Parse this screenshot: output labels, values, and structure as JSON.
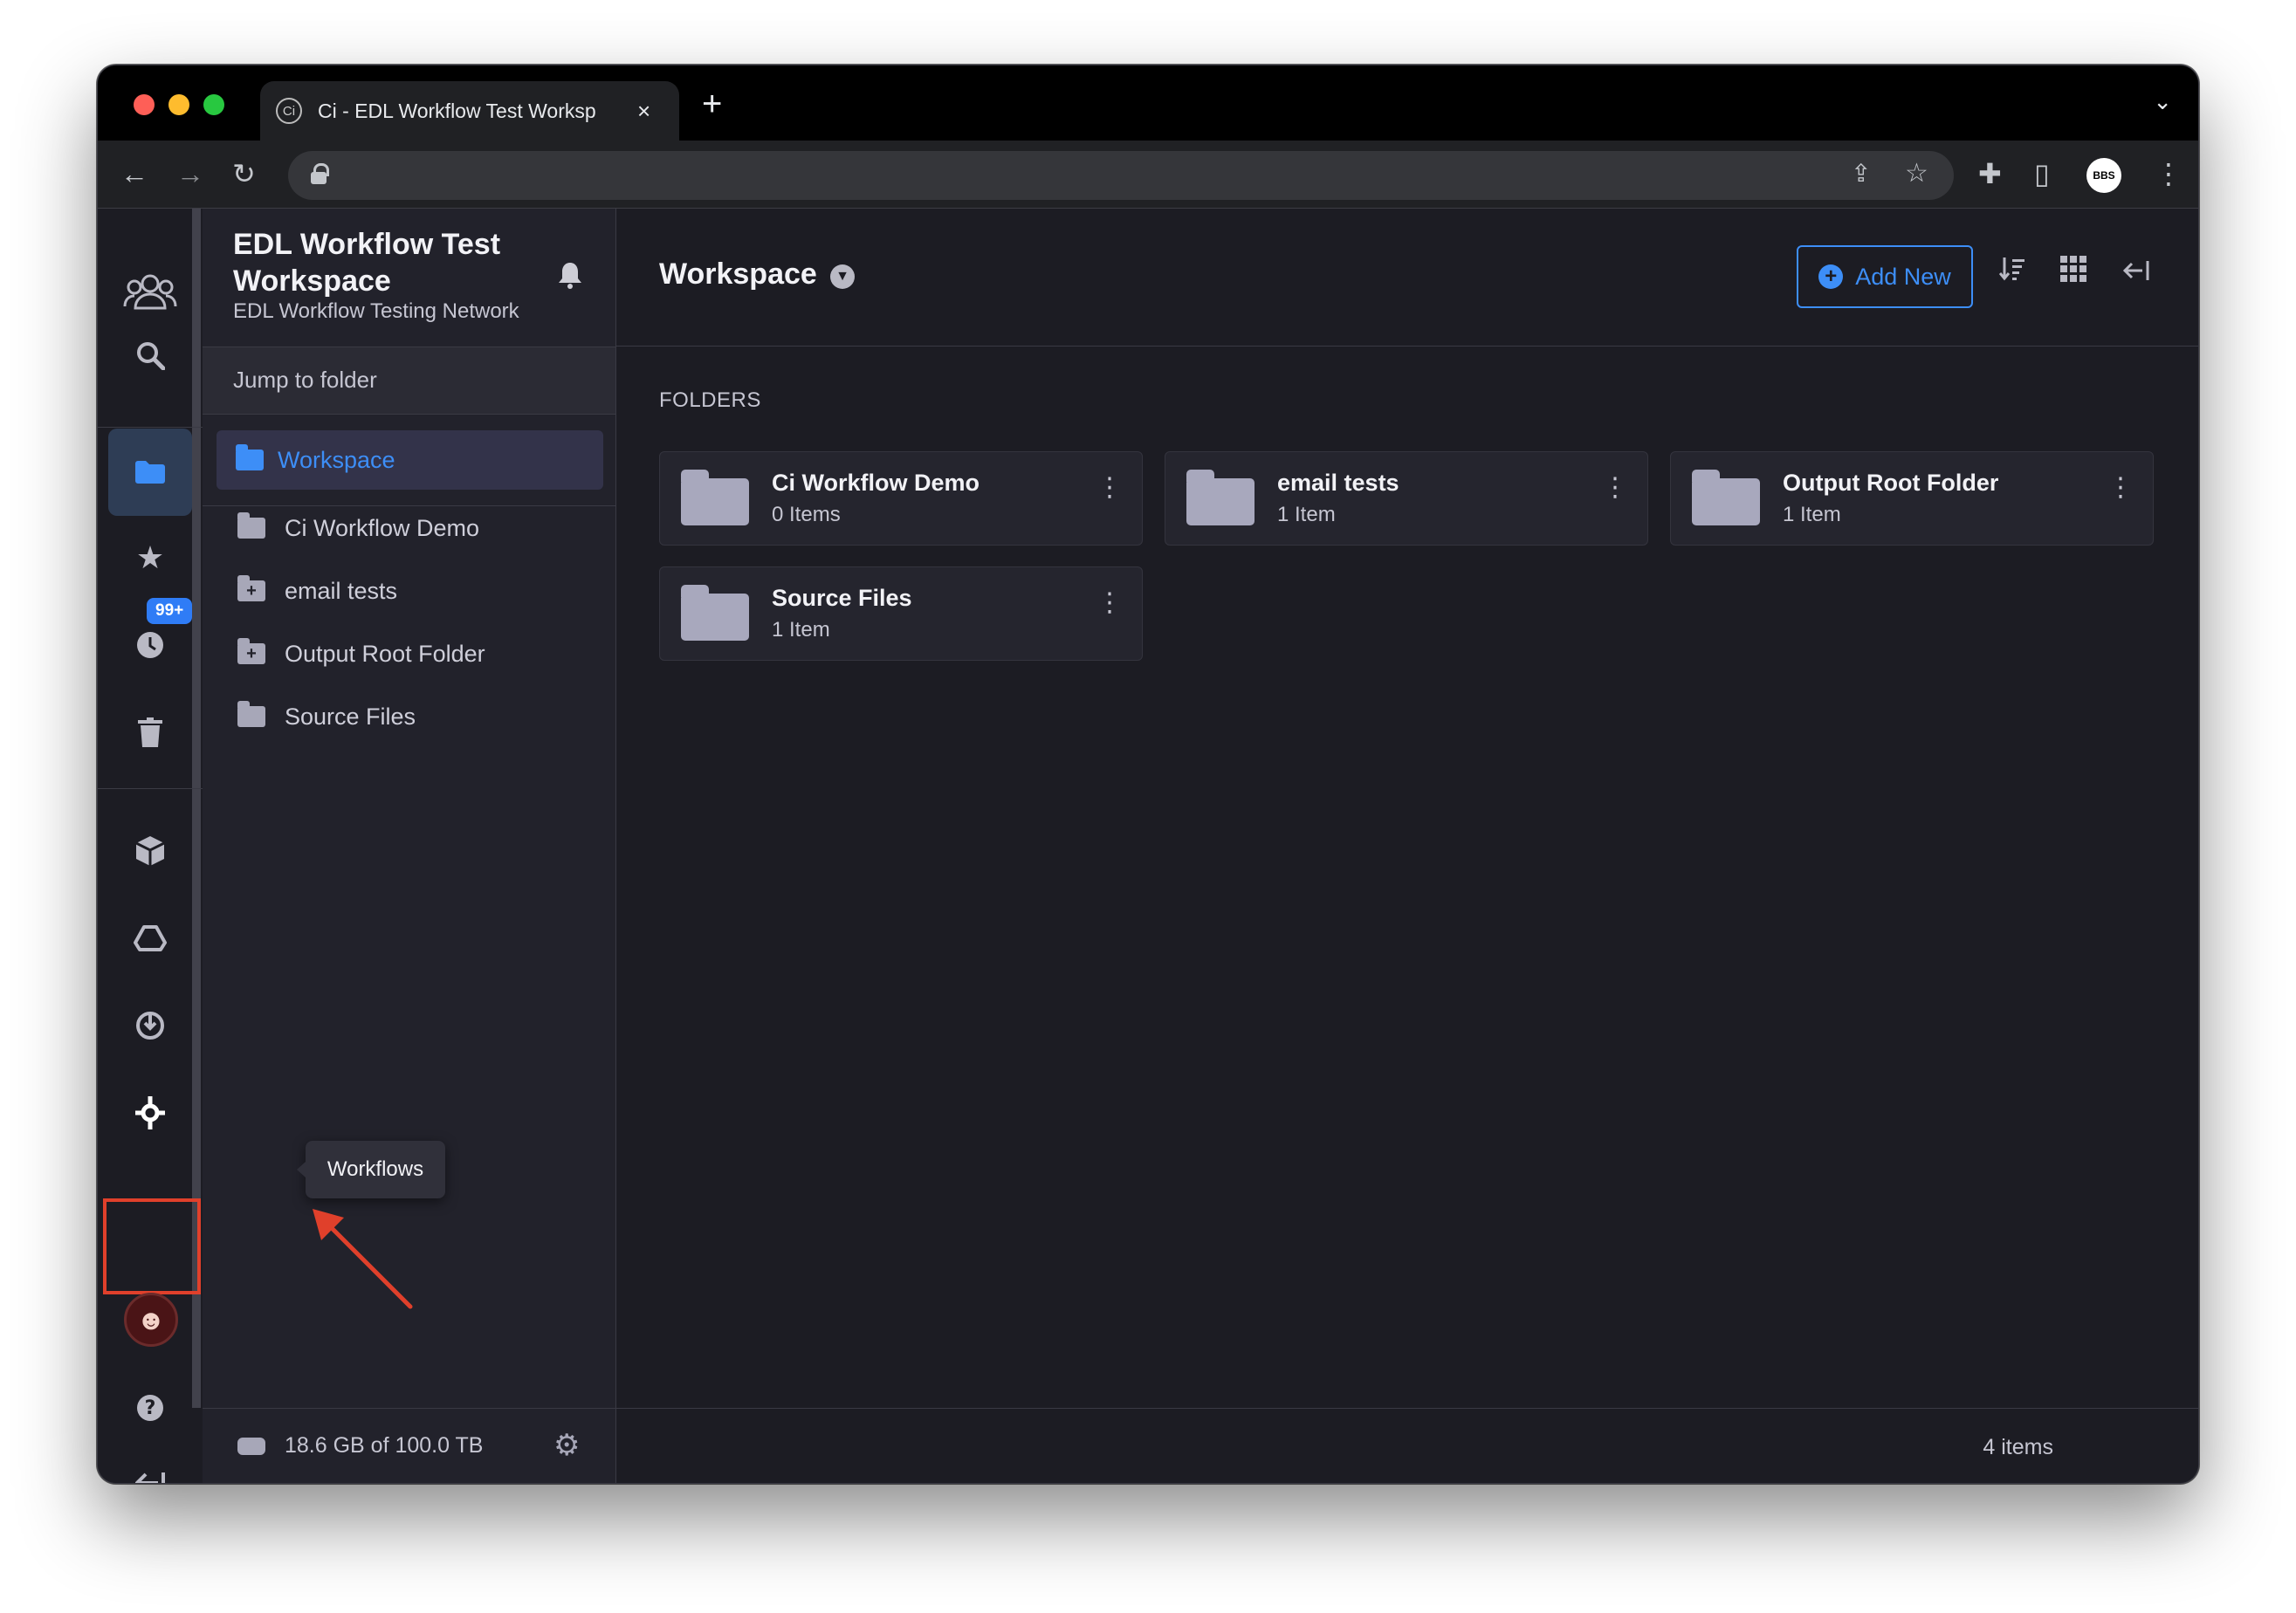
{
  "browser": {
    "tab_favicon": "Ci",
    "tab_title": "Ci - EDL Workflow Test Worksp",
    "tab_close": "×",
    "new_tab": "+",
    "profile_label": "BBS"
  },
  "workspace": {
    "title": "EDL Workflow Test Workspace",
    "network": "EDL Workflow Testing Network",
    "jump_placeholder": "Jump to folder"
  },
  "rail": {
    "badge": "99+",
    "tooltip": "Workflows",
    "icons": [
      "people-icon",
      "search-icon",
      "folder-icon",
      "star-icon",
      "recent-icon",
      "trash-icon",
      "package-icon",
      "drive-icon",
      "download-icon",
      "workflows-icon",
      "avatar",
      "help-icon",
      "collapse-icon"
    ]
  },
  "sidebar": {
    "root_label": "Workspace",
    "folders": [
      {
        "label": "Ci Workflow Demo",
        "glyph": ""
      },
      {
        "label": "email tests",
        "glyph": "+"
      },
      {
        "label": "Output Root Folder",
        "glyph": "+"
      },
      {
        "label": "Source Files",
        "glyph": ""
      }
    ],
    "storage": "18.6 GB of 100.0 TB"
  },
  "main": {
    "title": "Workspace",
    "add_new": "Add New",
    "folders_heading": "FOLDERS",
    "cards": [
      {
        "name": "Ci Workflow Demo",
        "count": "0 Items"
      },
      {
        "name": "email tests",
        "count": "1 Item"
      },
      {
        "name": "Output Root Folder",
        "count": "1 Item"
      },
      {
        "name": "Source Files",
        "count": "1 Item"
      }
    ],
    "items_count": "4 items"
  },
  "colors": {
    "accent": "#3d8ef7",
    "highlight": "#e0402b",
    "background": "#1c1c23"
  }
}
